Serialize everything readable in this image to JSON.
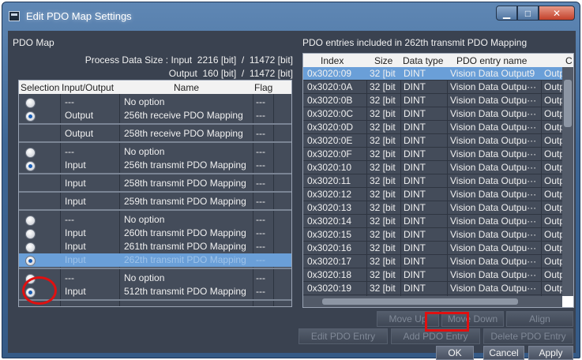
{
  "window": {
    "title": "Edit PDO Map Settings",
    "controls": {
      "minimize": "▁",
      "maximize": "□",
      "close": "✕"
    }
  },
  "left": {
    "header": "PDO Map",
    "process_size_line": "Process Data Size : Input  2216 [bit]  /  11472 [bit]",
    "output_size_line": "Output  160 [bit]  /  11472 [bit]",
    "columns": {
      "selection": "Selection",
      "io": "Input/Output",
      "name": "Name",
      "flag": "Flag"
    },
    "groups": [
      {
        "rows": [
          {
            "selected": false,
            "io": "---",
            "name": "No option",
            "flag": "---"
          },
          {
            "selected": true,
            "io": "Output",
            "name": "256th receive PDO Mapping",
            "flag": "---"
          }
        ]
      },
      {
        "rows": [
          {
            "io": "Output",
            "name": "258th receive PDO Mapping",
            "flag": "---"
          }
        ]
      },
      {
        "rows": [
          {
            "selected": false,
            "io": "---",
            "name": "No option",
            "flag": "---"
          },
          {
            "selected": true,
            "io": "Input",
            "name": "256th transmit PDO Mapping",
            "flag": "---"
          }
        ]
      },
      {
        "rows": [
          {
            "io": "Input",
            "name": "258th transmit PDO Mapping",
            "flag": "---"
          }
        ]
      },
      {
        "rows": [
          {
            "io": "Input",
            "name": "259th transmit PDO Mapping",
            "flag": "---"
          }
        ]
      },
      {
        "rows": [
          {
            "selected": false,
            "io": "---",
            "name": "No option",
            "flag": "---"
          },
          {
            "selected": false,
            "io": "Input",
            "name": "260th transmit PDO Mapping",
            "flag": "---"
          },
          {
            "selected": false,
            "io": "Input",
            "name": "261th transmit PDO Mapping",
            "flag": "---"
          },
          {
            "selected": true,
            "io": "Input",
            "name": "262th transmit PDO Mapping",
            "flag": "---",
            "highlighted": true
          }
        ]
      },
      {
        "rows": [
          {
            "selected": false,
            "io": "---",
            "name": "No option",
            "flag": "---"
          },
          {
            "selected": true,
            "io": "Input",
            "name": "512th transmit PDO Mapping",
            "flag": "---"
          }
        ]
      }
    ]
  },
  "right": {
    "header": "PDO entries included in 262th transmit PDO Mapping",
    "columns": {
      "index": "Index",
      "size": "Size",
      "type": "Data type",
      "name": "PDO entry name",
      "out": "C"
    },
    "rows": [
      {
        "index": "0x3020:09",
        "size": "32 [bit",
        "type": "DINT",
        "name": "Vision Data Output9",
        "out": "Outpu",
        "selected": true
      },
      {
        "index": "0x3020:0A",
        "size": "32 [bit",
        "type": "DINT",
        "name": "Vision Data Outpu···",
        "out": "Outpu"
      },
      {
        "index": "0x3020:0B",
        "size": "32 [bit",
        "type": "DINT",
        "name": "Vision Data Outpu···",
        "out": "Outpu"
      },
      {
        "index": "0x3020:0C",
        "size": "32 [bit",
        "type": "DINT",
        "name": "Vision Data Outpu···",
        "out": "Outpu"
      },
      {
        "index": "0x3020:0D",
        "size": "32 [bit",
        "type": "DINT",
        "name": "Vision Data Outpu···",
        "out": "Outpu"
      },
      {
        "index": "0x3020:0E",
        "size": "32 [bit",
        "type": "DINT",
        "name": "Vision Data Outpu···",
        "out": "Outpu"
      },
      {
        "index": "0x3020:0F",
        "size": "32 [bit",
        "type": "DINT",
        "name": "Vision Data Outpu···",
        "out": "Outpu"
      },
      {
        "index": "0x3020:10",
        "size": "32 [bit",
        "type": "DINT",
        "name": "Vision Data Outpu···",
        "out": "Outpu"
      },
      {
        "index": "0x3020:11",
        "size": "32 [bit",
        "type": "DINT",
        "name": "Vision Data Outpu···",
        "out": "Outpu"
      },
      {
        "index": "0x3020:12",
        "size": "32 [bit",
        "type": "DINT",
        "name": "Vision Data Outpu···",
        "out": "Outpu"
      },
      {
        "index": "0x3020:13",
        "size": "32 [bit",
        "type": "DINT",
        "name": "Vision Data Outpu···",
        "out": "Outpu"
      },
      {
        "index": "0x3020:14",
        "size": "32 [bit",
        "type": "DINT",
        "name": "Vision Data Outpu···",
        "out": "Outpu"
      },
      {
        "index": "0x3020:15",
        "size": "32 [bit",
        "type": "DINT",
        "name": "Vision Data Outpu···",
        "out": "Outpu"
      },
      {
        "index": "0x3020:16",
        "size": "32 [bit",
        "type": "DINT",
        "name": "Vision Data Outpu···",
        "out": "Outpu"
      },
      {
        "index": "0x3020:17",
        "size": "32 [bit",
        "type": "DINT",
        "name": "Vision Data Outpu···",
        "out": "Outpu"
      },
      {
        "index": "0x3020:18",
        "size": "32 [bit",
        "type": "DINT",
        "name": "Vision Data Outpu···",
        "out": "Outpu"
      },
      {
        "index": "0x3020:19",
        "size": "32 [bit",
        "type": "DINT",
        "name": "Vision Data Outpu···",
        "out": "Outpu"
      }
    ]
  },
  "buttons": {
    "move_up": "Move Up",
    "move_down": "Move Down",
    "align": "Align",
    "edit_entry": "Edit PDO Entry",
    "add_entry": "Add PDO Entry",
    "delete_entry": "Delete PDO Entry",
    "ok": "OK",
    "cancel": "Cancel",
    "apply": "Apply"
  }
}
